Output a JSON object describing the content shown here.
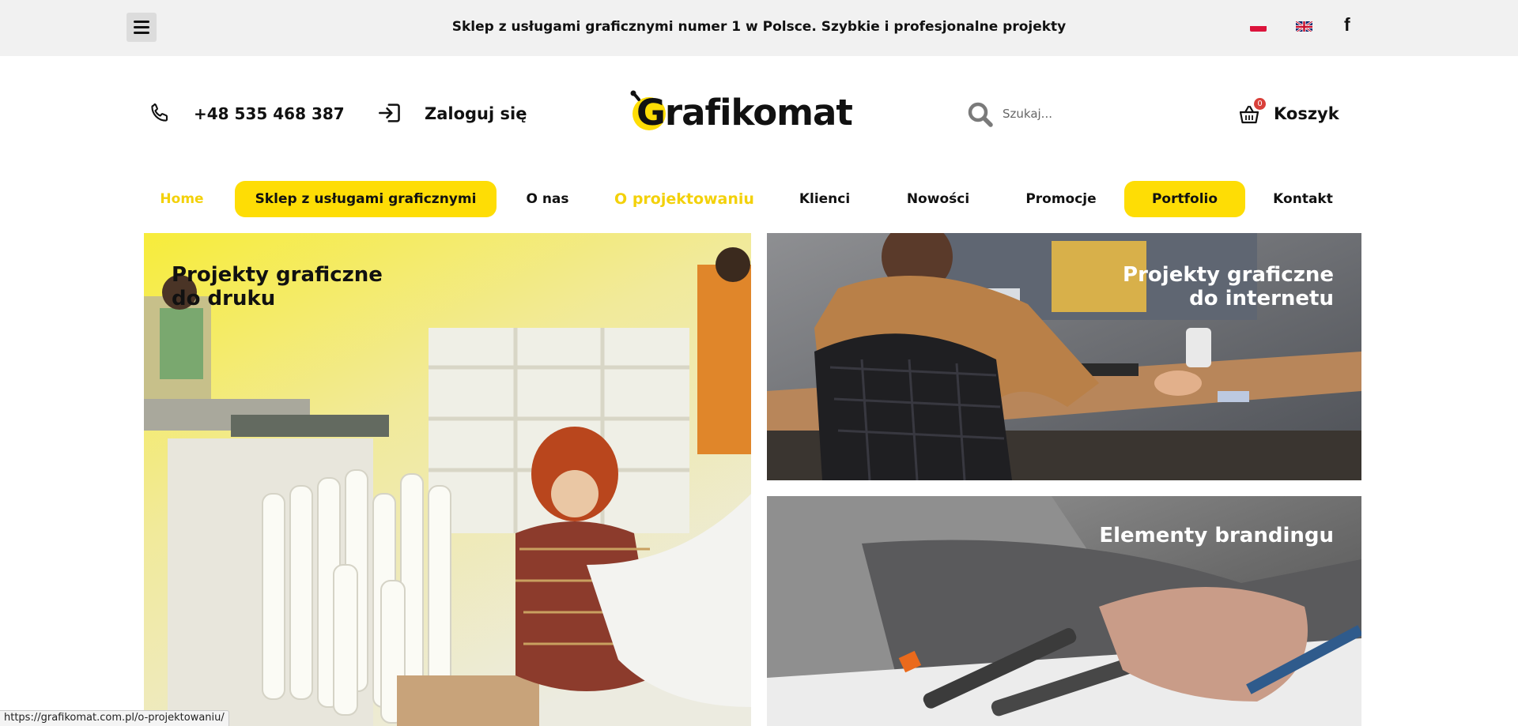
{
  "topbar": {
    "tagline": "Sklep z usługami graficznymi numer 1 w Polsce. Szybkie i profesjonalne projekty",
    "facebook_glyph": "f",
    "icons": [
      "menu-icon",
      "flag-pl-icon",
      "flag-en-icon",
      "facebook-icon"
    ]
  },
  "header": {
    "phone": "+48 535 468 387",
    "login": "Zaloguj się",
    "logo_text": "Grafikomat",
    "search_placeholder": "Szukaj...",
    "cart_label": "Koszyk",
    "cart_count": "0",
    "icons": [
      "phone-icon",
      "login-icon",
      "search-icon",
      "cart-icon"
    ]
  },
  "nav": {
    "items": [
      {
        "label": "Home"
      },
      {
        "label": "Sklep z usługami graficznymi"
      },
      {
        "label": "O nas"
      },
      {
        "label": "O projektowaniu"
      },
      {
        "label": "Klienci"
      },
      {
        "label": "Nowości"
      },
      {
        "label": "Promocje"
      },
      {
        "label": "Portfolio"
      },
      {
        "label": "Kontakt"
      }
    ]
  },
  "tiles": {
    "print_line1": "Projekty graficzne",
    "print_line2": "do druku",
    "web_line1": "Projekty graficzne",
    "web_line2": "do internetu",
    "branding": "Elementy brandingu"
  },
  "status": {
    "url": "https://grafikomat.com.pl/o-projektowaniu/"
  },
  "colors": {
    "accent_yellow": "#fedd05",
    "active_link": "#f3d10a",
    "topbar_bg": "#f1f1f1",
    "badge_red": "#d9403a",
    "text": "#111111"
  }
}
